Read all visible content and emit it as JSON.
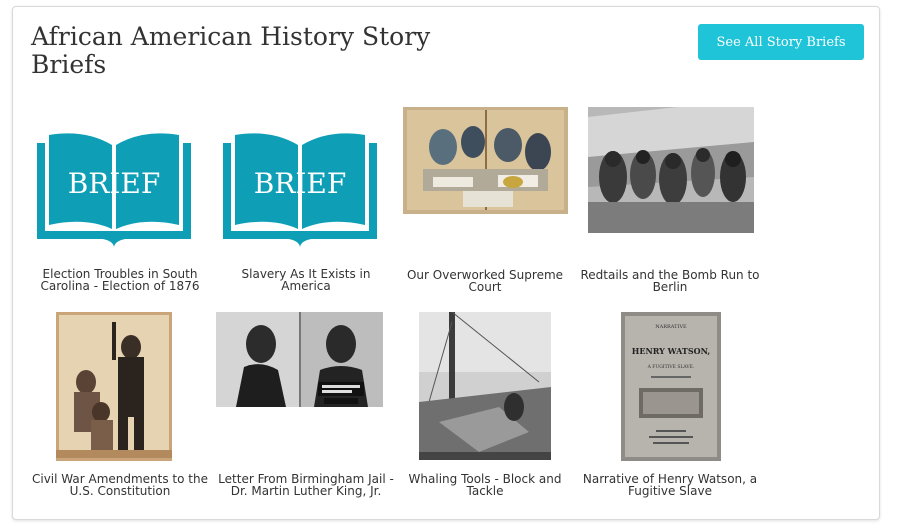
{
  "header": {
    "title": "African American History Story Briefs",
    "see_all_label": "See All Story Briefs"
  },
  "brief_icon": {
    "text": "BRIEF",
    "color": "#0e9fb6"
  },
  "items": [
    {
      "caption": "Election Troubles in South Carolina - Election of 1876",
      "thumb": "brief-book-icon"
    },
    {
      "caption": "Slavery As It Exists in America",
      "thumb": "brief-book-icon"
    },
    {
      "caption": "Our Overworked Supreme Court",
      "thumb": "supreme-court-cartoon-image"
    },
    {
      "caption": "Redtails and the Bomb Run to Berlin",
      "thumb": "tuskegee-airmen-photo"
    },
    {
      "caption": "Civil War Amendments to the U.S. Constitution",
      "thumb": "lincoln-emancipation-engraving"
    },
    {
      "caption": "Letter From Birmingham Jail - Dr. Martin Luther King, Jr.",
      "thumb": "mugshot-photo"
    },
    {
      "caption": "Whaling Tools - Block and Tackle",
      "thumb": "whaling-ship-photo"
    },
    {
      "caption": "Narrative of Henry Watson, a Fugitive Slave",
      "thumb": "book-cover-image"
    }
  ],
  "book_cover": {
    "line1": "NARRATIVE",
    "line2": "HENRY WATSON,",
    "line3": "A FUGITIVE SLAVE."
  }
}
